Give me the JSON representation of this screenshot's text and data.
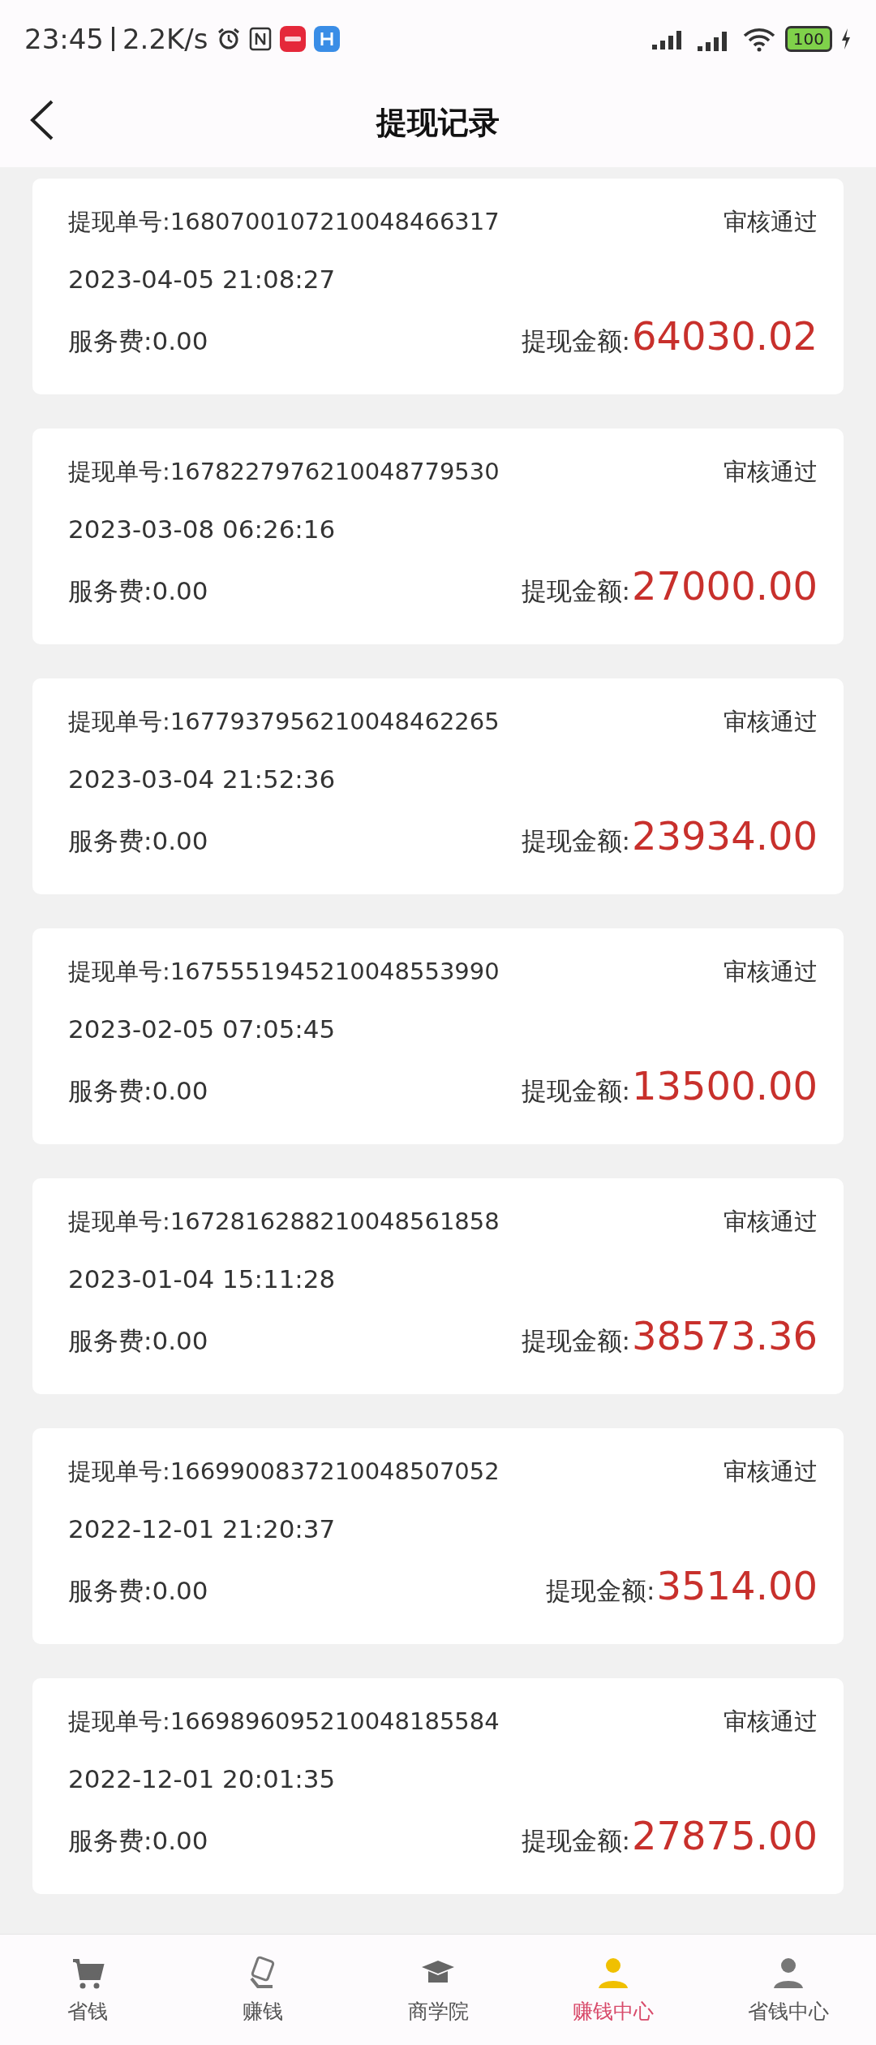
{
  "status_bar": {
    "time": "23:45",
    "speed": "2.2K/s",
    "battery": "100"
  },
  "header": {
    "title": "提现记录"
  },
  "records": [
    {
      "order_label": "提现单号:",
      "order_no": "1680700107210048466317",
      "status": "审核通过",
      "time": "2023-04-05 21:08:27",
      "fee": "服务费:0.00",
      "amount_label": "提现金额:",
      "amount": "64030.02"
    },
    {
      "order_label": "提现单号:",
      "order_no": "1678227976210048779530",
      "status": "审核通过",
      "time": "2023-03-08 06:26:16",
      "fee": "服务费:0.00",
      "amount_label": "提现金额:",
      "amount": "27000.00"
    },
    {
      "order_label": "提现单号:",
      "order_no": "1677937956210048462265",
      "status": "审核通过",
      "time": "2023-03-04 21:52:36",
      "fee": "服务费:0.00",
      "amount_label": "提现金额:",
      "amount": "23934.00"
    },
    {
      "order_label": "提现单号:",
      "order_no": "1675551945210048553990",
      "status": "审核通过",
      "time": "2023-02-05 07:05:45",
      "fee": "服务费:0.00",
      "amount_label": "提现金额:",
      "amount": "13500.00"
    },
    {
      "order_label": "提现单号:",
      "order_no": "1672816288210048561858",
      "status": "审核通过",
      "time": "2023-01-04 15:11:28",
      "fee": "服务费:0.00",
      "amount_label": "提现金额:",
      "amount": "38573.36"
    },
    {
      "order_label": "提现单号:",
      "order_no": "1669900837210048507052",
      "status": "审核通过",
      "time": "2022-12-01 21:20:37",
      "fee": "服务费:0.00",
      "amount_label": "提现金额:",
      "amount": "3514.00"
    },
    {
      "order_label": "提现单号:",
      "order_no": "1669896095210048185584",
      "status": "审核通过",
      "time": "2022-12-01 20:01:35",
      "fee": "服务费:0.00",
      "amount_label": "提现金额:",
      "amount": "27875.00"
    }
  ],
  "tab_bar": [
    {
      "label": "省钱",
      "kind": "cart",
      "selected": false
    },
    {
      "label": "赚钱",
      "kind": "card",
      "selected": false
    },
    {
      "label": "商学院",
      "kind": "cap",
      "selected": false
    },
    {
      "label": "赚钱中心",
      "kind": "person",
      "selected": true
    },
    {
      "label": "省钱中心",
      "kind": "person",
      "selected": false
    }
  ]
}
